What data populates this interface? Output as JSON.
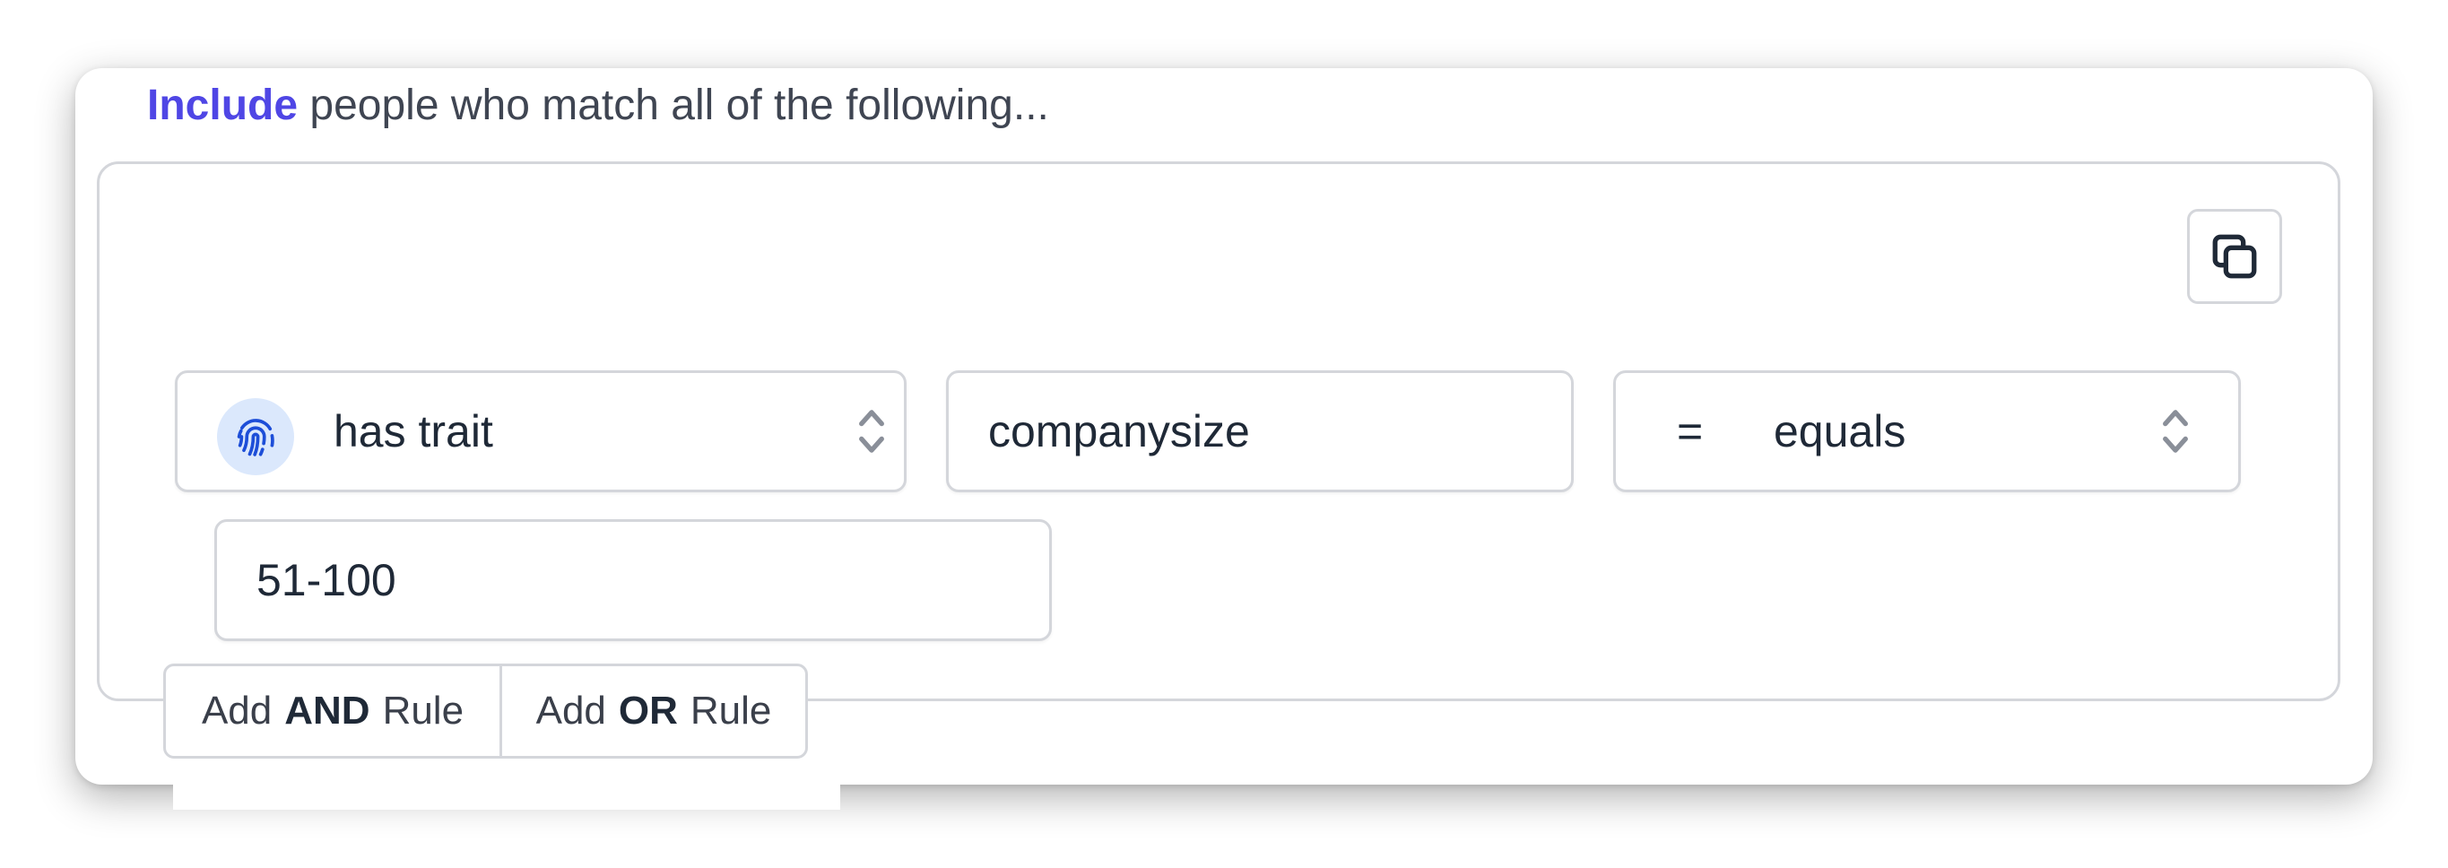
{
  "segment": {
    "heading_accent": "Include",
    "heading_rest": "people who match all of the following..."
  },
  "rule": {
    "condition": {
      "icon": "fingerprint-icon",
      "label": "has trait"
    },
    "trait_key": "companysize",
    "operator": {
      "symbol": "=",
      "label": "equals"
    },
    "value": "51-100"
  },
  "actions": {
    "add_and": {
      "prefix": "Add",
      "bold": "AND",
      "suffix": "Rule"
    },
    "add_or": {
      "prefix": "Add",
      "bold": "OR",
      "suffix": "Rule"
    },
    "copy_icon": "copy-icon"
  },
  "colors": {
    "accent": "#4f46e5",
    "icon_blue": "#1d4ed8",
    "icon_bg": "#dbe8fc",
    "border": "#d4d6db"
  }
}
